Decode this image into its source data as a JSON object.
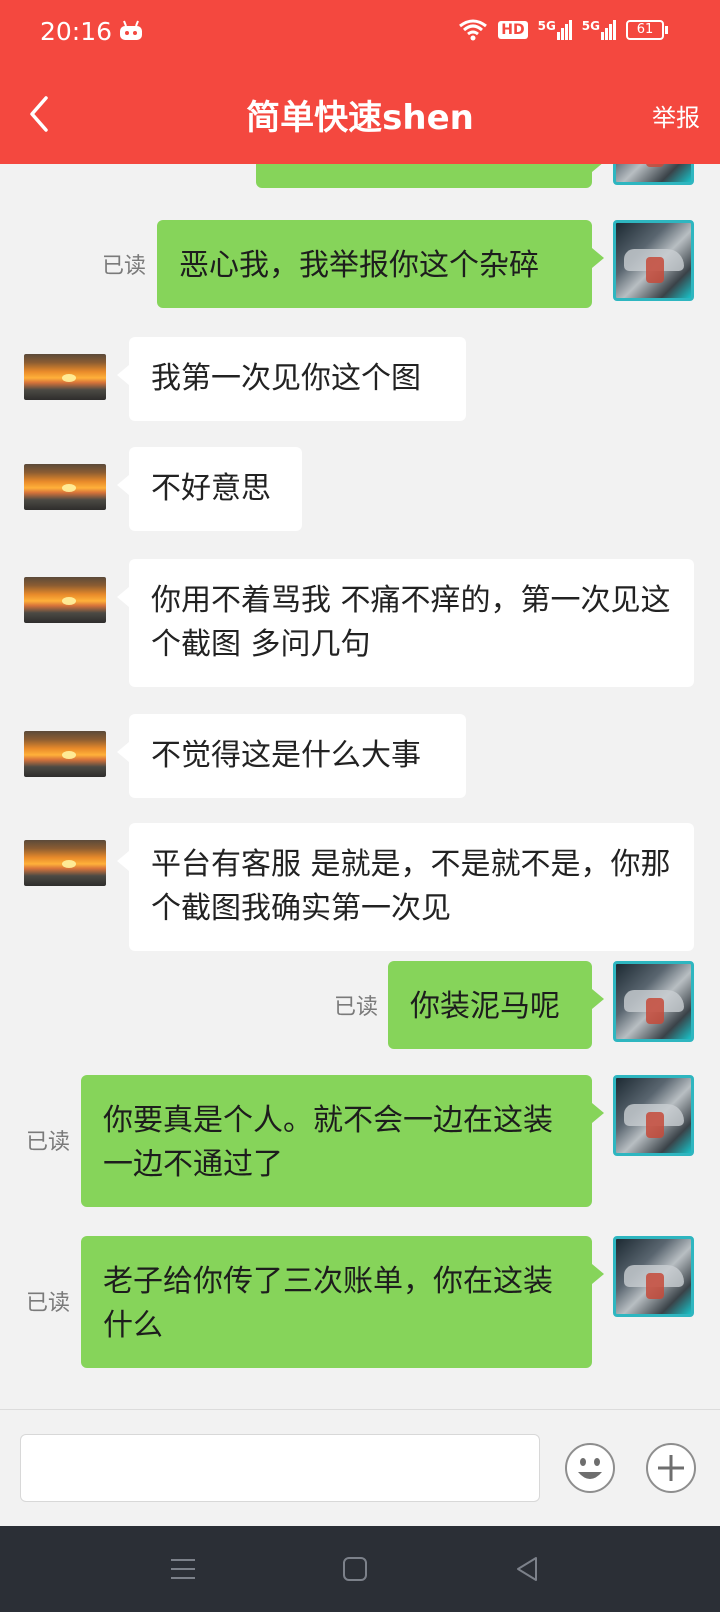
{
  "status_bar": {
    "time": "20:16",
    "battery": "61",
    "network_1": "5G",
    "network_2": "5G",
    "hd": "HD"
  },
  "header": {
    "title": "简单快速shen",
    "report_label": "举报"
  },
  "messages": [
    {
      "side": "out",
      "text": "恶心我，我举报你这个杂碎",
      "read": "已读"
    },
    {
      "side": "in",
      "text": "我第一次见你这个图"
    },
    {
      "side": "in",
      "text": "不好意思"
    },
    {
      "side": "in",
      "text": "你用不着骂我 不痛不痒的，第一次见这个截图 多问几句"
    },
    {
      "side": "in",
      "text": "不觉得这是什么大事"
    },
    {
      "side": "in",
      "text": "平台有客服 是就是，不是就不是，你那个截图我确实第一次见"
    },
    {
      "side": "out",
      "text": "你装泥马呢",
      "read": "已读"
    },
    {
      "side": "out",
      "text": "你要真是个人。就不会一边在这装一边不通过了",
      "read": "已读"
    },
    {
      "side": "out",
      "text": "老子给你传了三次账单，你在这装什么",
      "read": "已读"
    }
  ],
  "input": {
    "placeholder": ""
  },
  "colors": {
    "accent": "#f4483f",
    "bubble_out": "#86d45a",
    "bubble_in": "#ffffff",
    "nav_bg": "#2b2f36"
  }
}
